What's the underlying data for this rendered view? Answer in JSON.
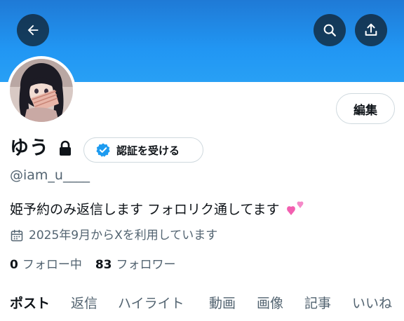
{
  "header": {
    "back_icon": "arrow-left-icon",
    "search_icon": "search-icon",
    "share_icon": "share-upload-icon",
    "banner_color": "#1d9bf0"
  },
  "profile": {
    "display_name": "ゆう",
    "lock_icon": "lock-icon",
    "verify_button_label": "認証を受ける",
    "verify_icon": "verified-badge-icon",
    "edit_button_label": "編集",
    "handle": "@iam_u____",
    "bio": "姫予約のみ返信します フォロリク通してます",
    "bio_emoji": "two-hearts-icon",
    "joined_icon": "calendar-icon",
    "joined_text": "2025年9月からXを利用しています",
    "following_count": "0",
    "following_label": "フォロー中",
    "followers_count": "83",
    "followers_label": "フォロワー"
  },
  "tabs": [
    {
      "label": "ポスト",
      "active": true
    },
    {
      "label": "返信",
      "active": false
    },
    {
      "label": "ハイライト",
      "active": false
    },
    {
      "label": "動画",
      "active": false
    },
    {
      "label": "画像",
      "active": false
    },
    {
      "label": "記事",
      "active": false
    },
    {
      "label": "いいね",
      "active": false
    }
  ],
  "colors": {
    "text_primary": "#0f1419",
    "text_secondary": "#536471",
    "border": "#cfd9de",
    "verify_blue": "#1d9bf0",
    "heart_pink": "#f25fb0"
  }
}
